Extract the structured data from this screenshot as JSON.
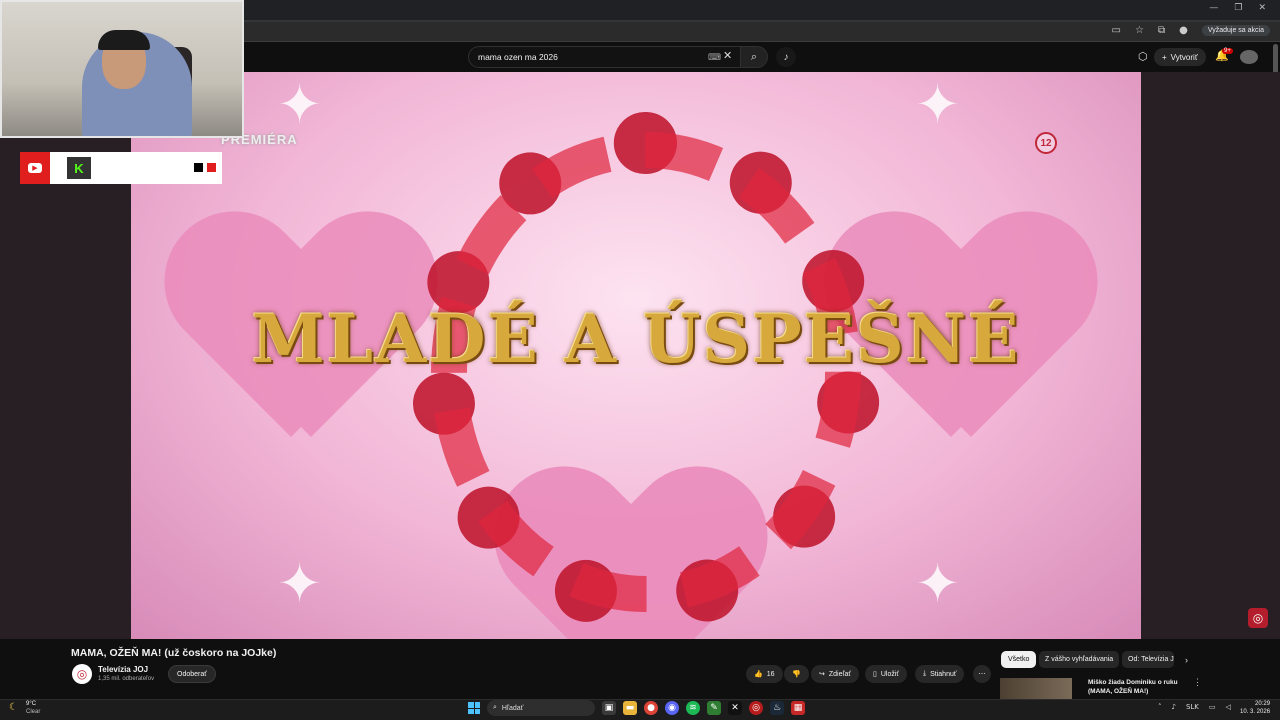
{
  "browser": {
    "window_controls": [
      "—",
      "❐",
      "✕"
    ],
    "sponsor_button": "Vyžaduje sa akcia",
    "icons": [
      "screen-cast-icon",
      "bookmark-star-icon",
      "extensions-icon",
      "profile-icon"
    ]
  },
  "youtube_header": {
    "search_query": "mama ozen ma 2026",
    "keyboard_icon": "⌨",
    "clear_icon": "✕",
    "search_icon": "⌕",
    "mic_icon": "🎙",
    "create_label": "Vytvoriť",
    "notifications_count": "9+"
  },
  "video": {
    "overlay_title": "MLADÉ A ÚSPEŠNÉ",
    "premiere_label": "PREMIÉRA",
    "age_rating": "12",
    "accent_color": "#c0162e"
  },
  "stream_overlay": {
    "kick_letter": "K",
    "youtube_symbol": "▶"
  },
  "video_info": {
    "title": "MAMA, OŽEŇ MA! (už čoskoro na JOJke)",
    "channel_name": "Televízia JOJ",
    "subscribers": "1,35 mil. odberateľov",
    "subscribe_button": "Odoberať",
    "likes": "16",
    "share": "Zdieľať",
    "save": "Uložiť",
    "download": "Stiahnuť",
    "more": "⋯"
  },
  "recommendations": {
    "chips": [
      "Všetko",
      "Z vášho vyhľadávania",
      "Od: Televízia JOJ"
    ],
    "first_title": "Miško žiada Dominiku o ruku (MAMA, OŽEŇ MA!)"
  },
  "taskbar": {
    "weather_temp": "9°C",
    "weather_desc": "Clear",
    "search_placeholder": "Hľadať",
    "language": "SLK",
    "time": "20:29",
    "date": "10. 3. 2026"
  }
}
